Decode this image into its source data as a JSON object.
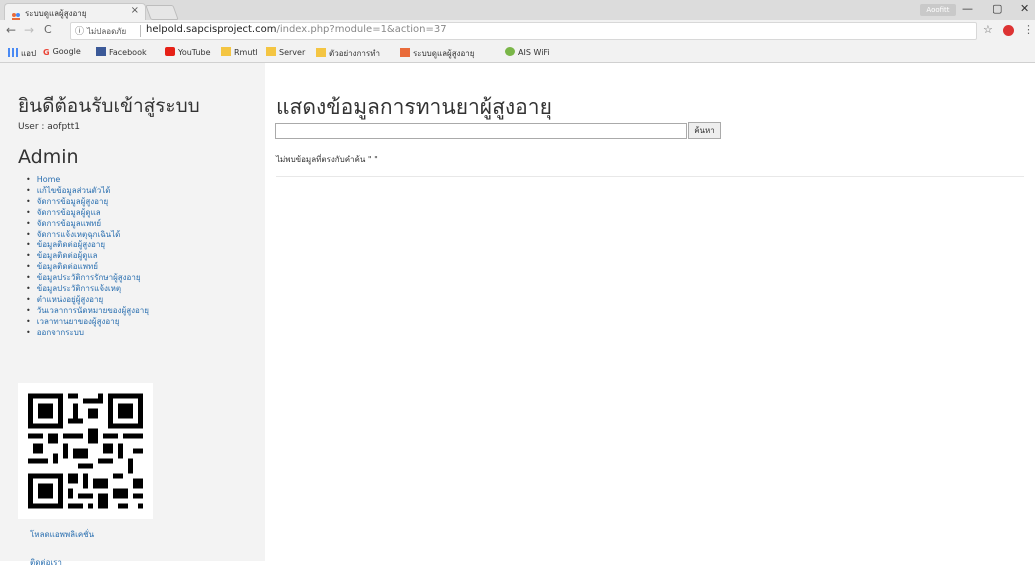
{
  "browser": {
    "tab_title": "ระบบดูแลผู้สูงอายุ",
    "tab_close": "×",
    "profile_name": "Aoofitt",
    "window_min": "—",
    "window_max": "▢",
    "window_close": "✕",
    "nav_back": "←",
    "nav_forward": "→",
    "nav_reload": "C",
    "insecure_label": "ไม่ปลอดภัย",
    "url_host": "helpold.sapcisproject.com",
    "url_path": "/index.php?module=1&action=37"
  },
  "bookmarks": [
    {
      "label": "แอป",
      "color": "#4a8af4"
    },
    {
      "label": "Google",
      "color": "#ea4335"
    },
    {
      "label": "Facebook",
      "color": "#3b5998"
    },
    {
      "label": "YouTube",
      "color": "#e62117"
    },
    {
      "label": "Rmutl",
      "color": "#f4c542"
    },
    {
      "label": "Server",
      "color": "#f4c542"
    },
    {
      "label": "ตัวอย่างการทำ",
      "color": "#f4c542"
    },
    {
      "label": "ระบบดูแลผู้สูงอายุ",
      "color": "#e96b3a"
    },
    {
      "label": "AIS WiFi",
      "color": "#7ab648"
    }
  ],
  "sidebar": {
    "welcome": "ยินดีต้อนรับเข้าสู่ระบบ",
    "user_line": "User : aofptt1",
    "role": "Admin",
    "menu": [
      "Home",
      "แก้ไขข้อมูลส่วนตัวได้",
      "จัดการข้อมูลผู้สูงอายุ",
      "จัดการข้อมูลผู้ดูแล",
      "จัดการข้อมูลแพทย์",
      "จัดการแจ้งเหตุฉุกเฉินได้",
      "ข้อมูลติดต่อผู้สูงอายุ",
      "ข้อมูลติดต่อผู้ดูแล",
      "ข้อมูลติดต่อแพทย์",
      "ข้อมูลประวัติการรักษาผู้สูงอายุ",
      "ข้อมูลประวัติการแจ้งเหตุ",
      "ตำแหน่งอยู่ผู้สูงอายุ",
      "วันเวลาการนัดหมายของผู้สูงอายุ",
      "เวลาทานยาของผู้สูงอายุ",
      "ออกจากระบบ"
    ],
    "download_link": "โหลดแอพพลิเคชั่น",
    "contact_link": "ติดต่อเรา"
  },
  "main": {
    "title": "แสดงข้อมูลการทานยาผู้สูงอายุ",
    "search_value": "",
    "search_button": "ค้นหา",
    "no_result": "ไม่พบข้อมูลที่ตรงกับคำค้น \" \""
  }
}
